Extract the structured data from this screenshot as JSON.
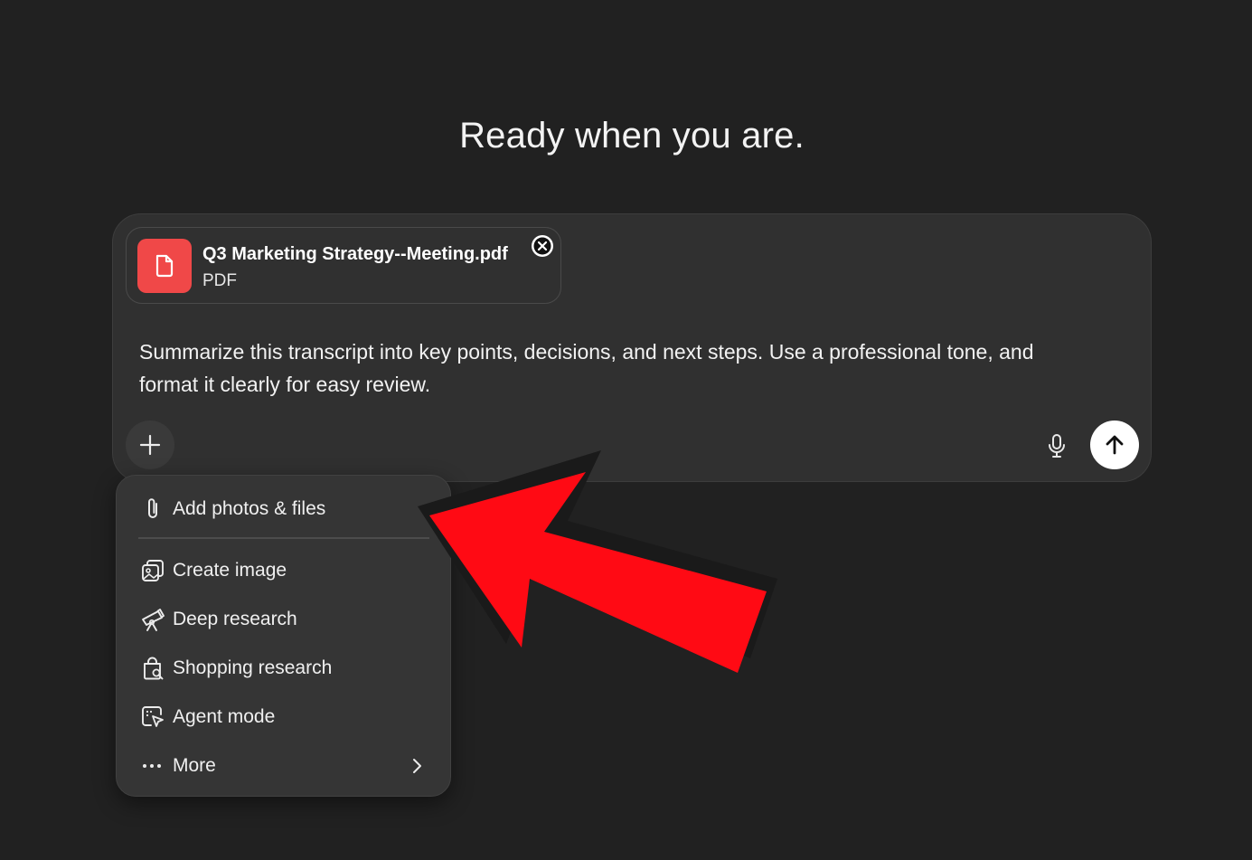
{
  "headline": "Ready when you are.",
  "composer": {
    "attachment": {
      "name": "Q3 Marketing Strategy--Meeting.pdf",
      "type": "PDF",
      "icon": "document-icon",
      "icon_color": "#f04848"
    },
    "prompt": "Summarize this transcript into key points, decisions, and next steps. Use a professional tone, and format it clearly for easy review.",
    "buttons": {
      "add": "plus-icon",
      "mic": "microphone-icon",
      "send": "arrow-up-icon"
    }
  },
  "menu": {
    "items": [
      {
        "label": "Add photos & files",
        "icon": "paperclip-icon"
      },
      {
        "label": "Create image",
        "icon": "image-icon"
      },
      {
        "label": "Deep research",
        "icon": "telescope-icon"
      },
      {
        "label": "Shopping research",
        "icon": "shopping-bag-icon"
      },
      {
        "label": "Agent mode",
        "icon": "agent-cursor-icon"
      },
      {
        "label": "More",
        "icon": "ellipsis-icon"
      }
    ]
  },
  "annotation": {
    "icon": "red-arrow-icon",
    "color": "#ff0a14"
  }
}
